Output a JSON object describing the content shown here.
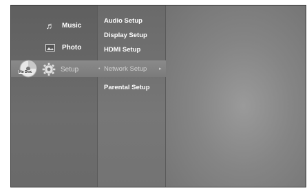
{
  "main_menu": {
    "items": [
      {
        "label": "Music",
        "icon": "music-icon"
      },
      {
        "label": "Photo",
        "icon": "photo-icon"
      },
      {
        "label": "Setup",
        "icon": "gear-icon"
      }
    ],
    "selected": "Setup"
  },
  "disc_status": {
    "label": "No Disc",
    "icon": "disc-icon"
  },
  "submenu": {
    "items": [
      {
        "label": "Audio Setup"
      },
      {
        "label": "Display Setup"
      },
      {
        "label": "HDMI Setup"
      },
      {
        "label": "Network Setup"
      },
      {
        "label": "Parental Setup"
      }
    ],
    "selected": "Network Setup"
  },
  "colors": {
    "background": "#7a7a7a",
    "text": "#ffffff",
    "highlight": "#8a8a8a"
  }
}
